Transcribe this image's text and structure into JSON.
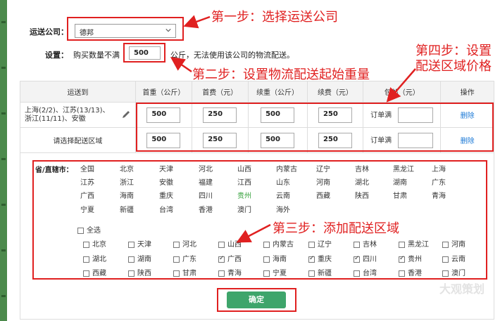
{
  "carrier": {
    "label": "运送公司：",
    "selected": "德邦"
  },
  "setting": {
    "label": "设置：",
    "prefix": "购买数量不满",
    "value": "500",
    "suffix": "公斤，无法使用该公司的物流配送。"
  },
  "annotations": {
    "step1": "第一步：选择运送公司",
    "step2": "第二步：设置物流配送起始重量",
    "step3": "第三步：添加配送区域",
    "step4_line1": "第四步：设置",
    "step4_line2": "配送区域价格"
  },
  "table": {
    "headers": [
      "运送到",
      "首重（公斤）",
      "首费（元）",
      "续重（公斤）",
      "续费（元）",
      "包邮（元）",
      "操作"
    ],
    "rows": [
      {
        "dest": "上海(2/2)、江苏(13/13)、浙江(11/11)、安徽",
        "first_weight": "500",
        "first_fee": "250",
        "add_weight": "500",
        "add_fee": "250",
        "free_label": "订单满",
        "free_value": "",
        "action": "删除"
      },
      {
        "dest": "请选择配送区域",
        "first_weight": "500",
        "first_fee": "250",
        "add_weight": "500",
        "add_fee": "250",
        "free_label": "订单满",
        "free_value": "",
        "action": "删除"
      }
    ]
  },
  "region": {
    "title": "省/直辖市：",
    "provinces": [
      [
        "全国",
        "北京",
        "天津",
        "河北",
        "山西",
        "内蒙古",
        "辽宁",
        "吉林",
        "黑龙江",
        "上海"
      ],
      [
        "江苏",
        "浙江",
        "安徽",
        "福建",
        "江西",
        "山东",
        "河南",
        "湖北",
        "湖南",
        "广东"
      ],
      [
        "广西",
        "海南",
        "重庆",
        "四川",
        "贵州",
        "云南",
        "西藏",
        "陕西",
        "甘肃",
        "青海"
      ],
      [
        "宁夏",
        "新疆",
        "台湾",
        "香港",
        "澳门",
        "海外"
      ]
    ],
    "highlighted": "贵州",
    "select_all": "全选",
    "checkbox_rows": [
      [
        {
          "n": "北京",
          "c": false
        },
        {
          "n": "天津",
          "c": false
        },
        {
          "n": "河北",
          "c": false
        },
        {
          "n": "山西",
          "c": false
        },
        {
          "n": "内蒙古",
          "c": false
        },
        {
          "n": "辽宁",
          "c": false
        },
        {
          "n": "吉林",
          "c": false
        },
        {
          "n": "黑龙江",
          "c": false
        },
        {
          "n": "河南",
          "c": false
        }
      ],
      [
        {
          "n": "湖北",
          "c": false
        },
        {
          "n": "湖南",
          "c": false
        },
        {
          "n": "广东",
          "c": false
        },
        {
          "n": "广西",
          "c": true
        },
        {
          "n": "海南",
          "c": false
        },
        {
          "n": "重庆",
          "c": true
        },
        {
          "n": "四川",
          "c": true
        },
        {
          "n": "贵州",
          "c": true
        },
        {
          "n": "云南",
          "c": false
        }
      ],
      [
        {
          "n": "西藏",
          "c": false
        },
        {
          "n": "陕西",
          "c": false
        },
        {
          "n": "甘肃",
          "c": false
        },
        {
          "n": "青海",
          "c": false
        },
        {
          "n": "宁夏",
          "c": false
        },
        {
          "n": "新疆",
          "c": false
        },
        {
          "n": "台湾",
          "c": false
        },
        {
          "n": "香港",
          "c": false
        },
        {
          "n": "澳门",
          "c": false
        }
      ]
    ]
  },
  "confirm": "确定",
  "watermark": "大观策划",
  "colors": {
    "annotation": "#e02020",
    "confirm_bg": "#3ea56b",
    "link": "#1a78d6",
    "highlight": "#3aa340"
  }
}
